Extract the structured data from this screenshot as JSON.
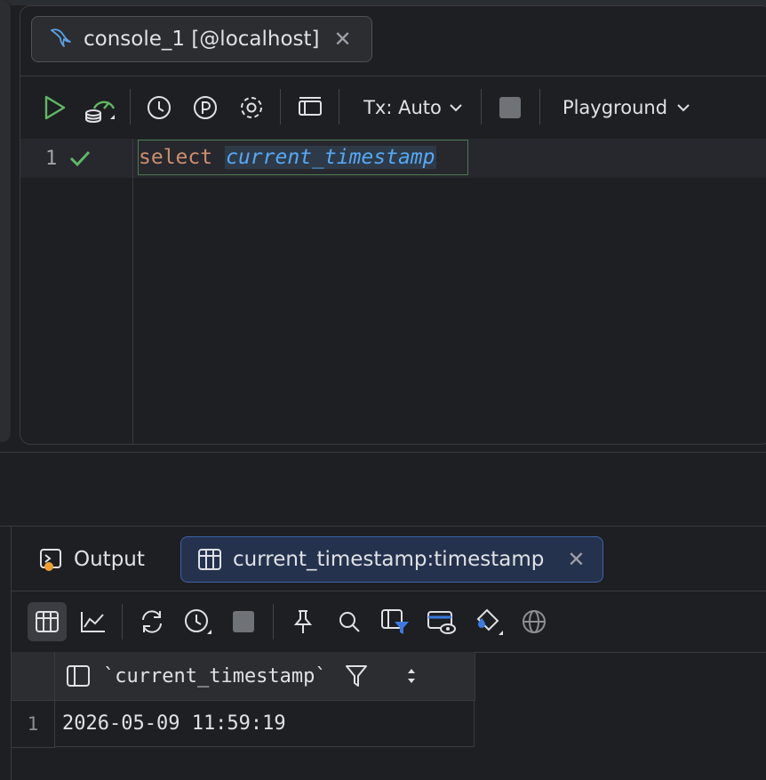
{
  "editor": {
    "tab_title": "console_1 [@localhost]",
    "toolbar": {
      "tx_label": "Tx: Auto",
      "playground_label": "Playground"
    },
    "lines": [
      {
        "number": "1",
        "keyword": "select",
        "function": "current_timestamp"
      }
    ]
  },
  "results": {
    "output_tab_label": "Output",
    "result_tab_label": "current_timestamp:timestamp",
    "column_header": "`current_timestamp`",
    "rows": [
      {
        "number": "1",
        "value": "2026-05-09 11:59:19"
      }
    ]
  },
  "colors": {
    "run_green": "#5fb865",
    "keyword": "#cf8e6d",
    "function": "#56a8f5",
    "active_tab": "#25324d"
  }
}
